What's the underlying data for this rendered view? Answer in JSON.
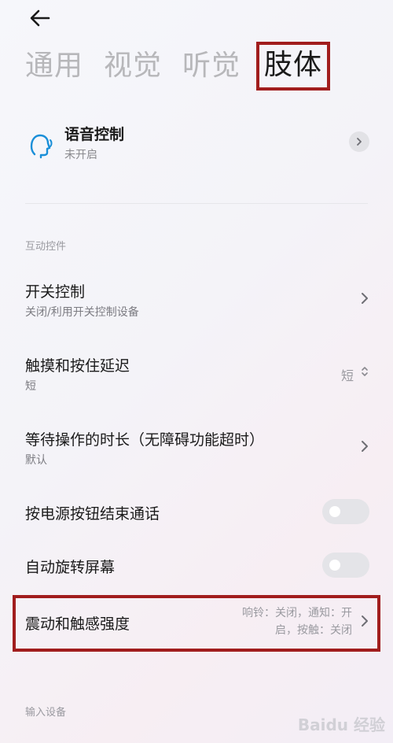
{
  "tabs": [
    {
      "label": "通用",
      "active": false
    },
    {
      "label": "视觉",
      "active": false
    },
    {
      "label": "听觉",
      "active": false
    },
    {
      "label": "肢体",
      "active": true
    }
  ],
  "voice_control": {
    "title": "语音控制",
    "status": "未开启"
  },
  "sections": {
    "interactive_controls": "互动控件",
    "input_devices": "输入设备"
  },
  "rows": {
    "switch_control": {
      "title": "开关控制",
      "subtitle": "关闭/利用开关控制设备"
    },
    "touch_hold_delay": {
      "title": "触摸和按住延迟",
      "subtitle": "短",
      "value": "短"
    },
    "wait_duration": {
      "title": "等待操作的时长（无障碍功能超时）",
      "subtitle": "默认"
    },
    "power_end_call": {
      "title": "按电源按钮结束通话",
      "toggle": false
    },
    "auto_rotate": {
      "title": "自动旋转屏幕",
      "toggle": false
    },
    "vibration": {
      "title": "震动和触感强度",
      "value_line1": "响铃：关闭，通知：开",
      "value_line2": "启，按触：关闭"
    }
  },
  "colors": {
    "highlight": "#a11d1d",
    "voice_icon": "#1a8fd8"
  },
  "watermark": "Baidu 经验"
}
